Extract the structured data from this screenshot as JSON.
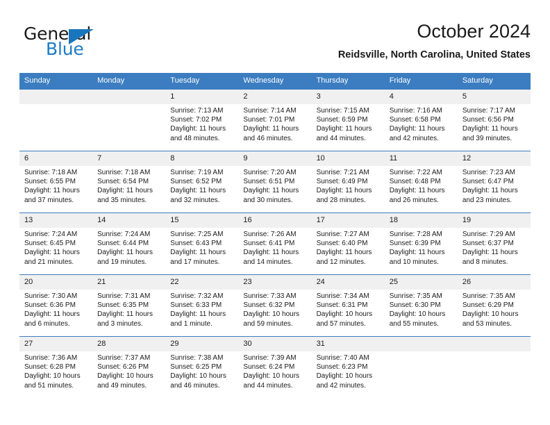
{
  "brand": {
    "name_part1": "General",
    "name_part2": "Blue",
    "triangle_icon": "triangle-icon"
  },
  "header": {
    "title": "October 2024",
    "subtitle": "Reidsville, North Carolina, United States"
  },
  "colors": {
    "header_blue": "#3b7dc0",
    "brand_blue": "#1d7cc4",
    "daynum_band": "#f0f0f0",
    "text": "#1a1a1a"
  },
  "weekday_headers": [
    "Sunday",
    "Monday",
    "Tuesday",
    "Wednesday",
    "Thursday",
    "Friday",
    "Saturday"
  ],
  "labels": {
    "sunrise": "Sunrise:",
    "sunset": "Sunset:",
    "daylight": "Daylight:"
  },
  "weeks": [
    [
      {
        "day": "",
        "blank": true
      },
      {
        "day": "",
        "blank": true
      },
      {
        "day": "1",
        "sunrise": "Sunrise: 7:13 AM",
        "sunset": "Sunset: 7:02 PM",
        "daylight": "Daylight: 11 hours and 48 minutes."
      },
      {
        "day": "2",
        "sunrise": "Sunrise: 7:14 AM",
        "sunset": "Sunset: 7:01 PM",
        "daylight": "Daylight: 11 hours and 46 minutes."
      },
      {
        "day": "3",
        "sunrise": "Sunrise: 7:15 AM",
        "sunset": "Sunset: 6:59 PM",
        "daylight": "Daylight: 11 hours and 44 minutes."
      },
      {
        "day": "4",
        "sunrise": "Sunrise: 7:16 AM",
        "sunset": "Sunset: 6:58 PM",
        "daylight": "Daylight: 11 hours and 42 minutes."
      },
      {
        "day": "5",
        "sunrise": "Sunrise: 7:17 AM",
        "sunset": "Sunset: 6:56 PM",
        "daylight": "Daylight: 11 hours and 39 minutes."
      }
    ],
    [
      {
        "day": "6",
        "sunrise": "Sunrise: 7:18 AM",
        "sunset": "Sunset: 6:55 PM",
        "daylight": "Daylight: 11 hours and 37 minutes."
      },
      {
        "day": "7",
        "sunrise": "Sunrise: 7:18 AM",
        "sunset": "Sunset: 6:54 PM",
        "daylight": "Daylight: 11 hours and 35 minutes."
      },
      {
        "day": "8",
        "sunrise": "Sunrise: 7:19 AM",
        "sunset": "Sunset: 6:52 PM",
        "daylight": "Daylight: 11 hours and 32 minutes."
      },
      {
        "day": "9",
        "sunrise": "Sunrise: 7:20 AM",
        "sunset": "Sunset: 6:51 PM",
        "daylight": "Daylight: 11 hours and 30 minutes."
      },
      {
        "day": "10",
        "sunrise": "Sunrise: 7:21 AM",
        "sunset": "Sunset: 6:49 PM",
        "daylight": "Daylight: 11 hours and 28 minutes."
      },
      {
        "day": "11",
        "sunrise": "Sunrise: 7:22 AM",
        "sunset": "Sunset: 6:48 PM",
        "daylight": "Daylight: 11 hours and 26 minutes."
      },
      {
        "day": "12",
        "sunrise": "Sunrise: 7:23 AM",
        "sunset": "Sunset: 6:47 PM",
        "daylight": "Daylight: 11 hours and 23 minutes."
      }
    ],
    [
      {
        "day": "13",
        "sunrise": "Sunrise: 7:24 AM",
        "sunset": "Sunset: 6:45 PM",
        "daylight": "Daylight: 11 hours and 21 minutes."
      },
      {
        "day": "14",
        "sunrise": "Sunrise: 7:24 AM",
        "sunset": "Sunset: 6:44 PM",
        "daylight": "Daylight: 11 hours and 19 minutes."
      },
      {
        "day": "15",
        "sunrise": "Sunrise: 7:25 AM",
        "sunset": "Sunset: 6:43 PM",
        "daylight": "Daylight: 11 hours and 17 minutes."
      },
      {
        "day": "16",
        "sunrise": "Sunrise: 7:26 AM",
        "sunset": "Sunset: 6:41 PM",
        "daylight": "Daylight: 11 hours and 14 minutes."
      },
      {
        "day": "17",
        "sunrise": "Sunrise: 7:27 AM",
        "sunset": "Sunset: 6:40 PM",
        "daylight": "Daylight: 11 hours and 12 minutes."
      },
      {
        "day": "18",
        "sunrise": "Sunrise: 7:28 AM",
        "sunset": "Sunset: 6:39 PM",
        "daylight": "Daylight: 11 hours and 10 minutes."
      },
      {
        "day": "19",
        "sunrise": "Sunrise: 7:29 AM",
        "sunset": "Sunset: 6:37 PM",
        "daylight": "Daylight: 11 hours and 8 minutes."
      }
    ],
    [
      {
        "day": "20",
        "sunrise": "Sunrise: 7:30 AM",
        "sunset": "Sunset: 6:36 PM",
        "daylight": "Daylight: 11 hours and 6 minutes."
      },
      {
        "day": "21",
        "sunrise": "Sunrise: 7:31 AM",
        "sunset": "Sunset: 6:35 PM",
        "daylight": "Daylight: 11 hours and 3 minutes."
      },
      {
        "day": "22",
        "sunrise": "Sunrise: 7:32 AM",
        "sunset": "Sunset: 6:33 PM",
        "daylight": "Daylight: 11 hours and 1 minute."
      },
      {
        "day": "23",
        "sunrise": "Sunrise: 7:33 AM",
        "sunset": "Sunset: 6:32 PM",
        "daylight": "Daylight: 10 hours and 59 minutes."
      },
      {
        "day": "24",
        "sunrise": "Sunrise: 7:34 AM",
        "sunset": "Sunset: 6:31 PM",
        "daylight": "Daylight: 10 hours and 57 minutes."
      },
      {
        "day": "25",
        "sunrise": "Sunrise: 7:35 AM",
        "sunset": "Sunset: 6:30 PM",
        "daylight": "Daylight: 10 hours and 55 minutes."
      },
      {
        "day": "26",
        "sunrise": "Sunrise: 7:35 AM",
        "sunset": "Sunset: 6:29 PM",
        "daylight": "Daylight: 10 hours and 53 minutes."
      }
    ],
    [
      {
        "day": "27",
        "sunrise": "Sunrise: 7:36 AM",
        "sunset": "Sunset: 6:28 PM",
        "daylight": "Daylight: 10 hours and 51 minutes."
      },
      {
        "day": "28",
        "sunrise": "Sunrise: 7:37 AM",
        "sunset": "Sunset: 6:26 PM",
        "daylight": "Daylight: 10 hours and 49 minutes."
      },
      {
        "day": "29",
        "sunrise": "Sunrise: 7:38 AM",
        "sunset": "Sunset: 6:25 PM",
        "daylight": "Daylight: 10 hours and 46 minutes."
      },
      {
        "day": "30",
        "sunrise": "Sunrise: 7:39 AM",
        "sunset": "Sunset: 6:24 PM",
        "daylight": "Daylight: 10 hours and 44 minutes."
      },
      {
        "day": "31",
        "sunrise": "Sunrise: 7:40 AM",
        "sunset": "Sunset: 6:23 PM",
        "daylight": "Daylight: 10 hours and 42 minutes."
      },
      {
        "day": "",
        "blank": true
      },
      {
        "day": "",
        "blank": true
      }
    ]
  ]
}
